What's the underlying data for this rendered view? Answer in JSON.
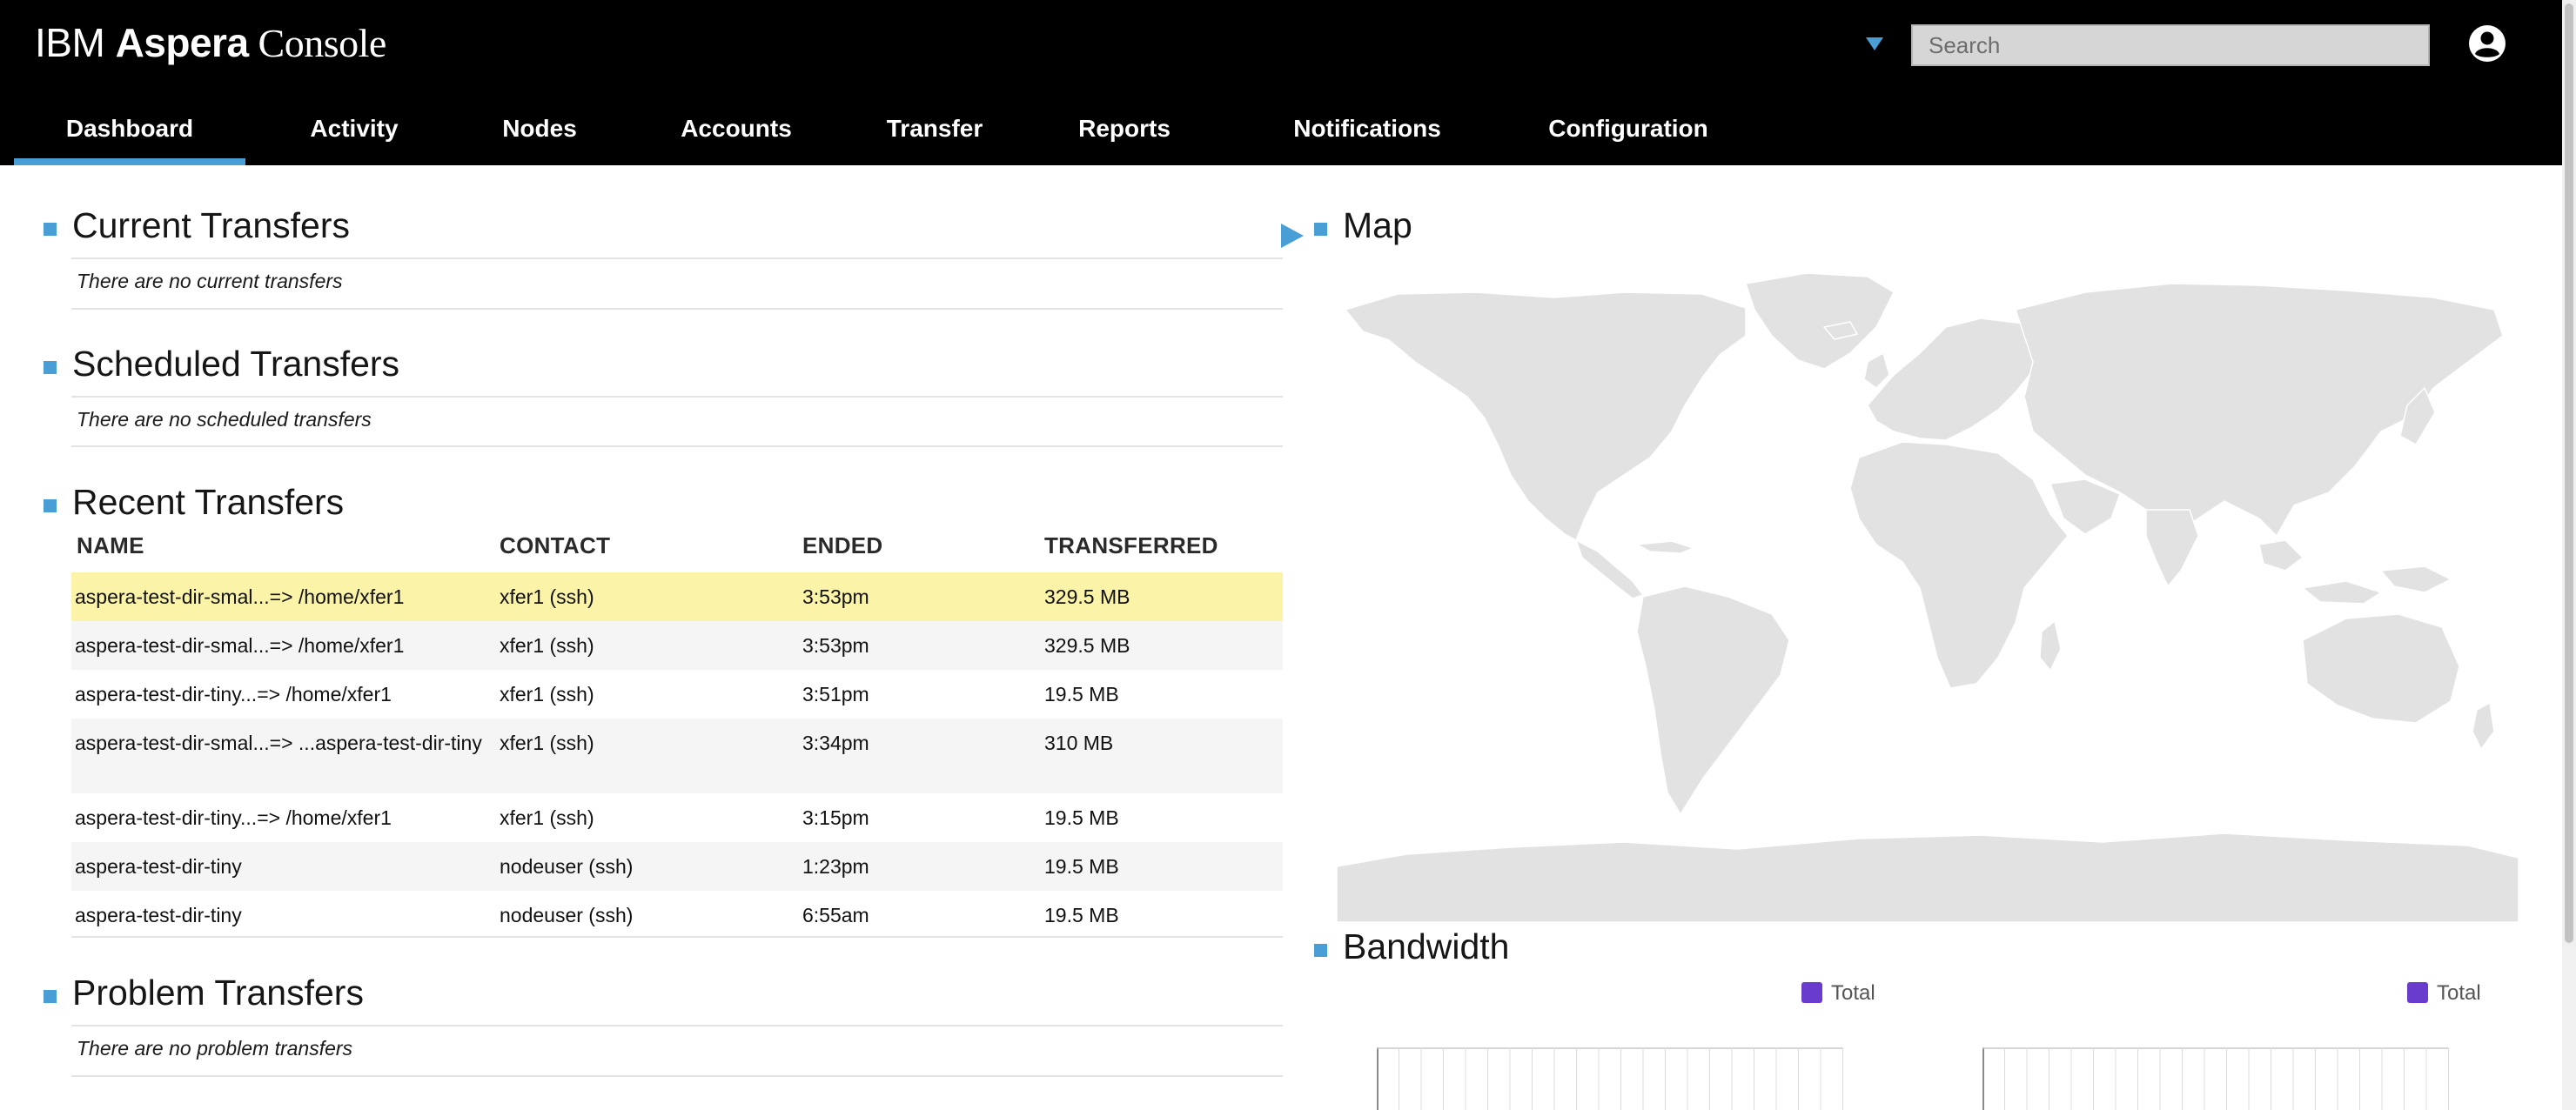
{
  "header": {
    "logo": {
      "part1": "IBM ",
      "part2": "Aspera",
      "part3": " Console"
    },
    "search_placeholder": "Search",
    "tabs": [
      {
        "label": "Dashboard",
        "active": true
      },
      {
        "label": "Activity"
      },
      {
        "label": "Nodes"
      },
      {
        "label": "Accounts"
      },
      {
        "label": "Transfer"
      },
      {
        "label": "Reports"
      },
      {
        "label": "Notifications"
      },
      {
        "label": "Configuration"
      }
    ],
    "icons": {
      "filter": "triangle-down-icon",
      "user": "user-avatar-icon"
    }
  },
  "current_transfers": {
    "title": "Current Transfers",
    "empty": "There are no current transfers"
  },
  "scheduled_transfers": {
    "title": "Scheduled Transfers",
    "empty": "There are no scheduled transfers"
  },
  "recent_transfers": {
    "title": "Recent Transfers",
    "columns": [
      "NAME",
      "CONTACT",
      "ENDED",
      "TRANSFERRED"
    ],
    "rows": [
      {
        "name": "aspera-test-dir-smal...=> /home/xfer1",
        "contact": "xfer1 (ssh)",
        "ended": "3:53pm",
        "transferred": "329.5 MB"
      },
      {
        "name": "aspera-test-dir-smal...=> /home/xfer1",
        "contact": "xfer1 (ssh)",
        "ended": "3:53pm",
        "transferred": "329.5 MB"
      },
      {
        "name": "aspera-test-dir-tiny...=> /home/xfer1",
        "contact": "xfer1 (ssh)",
        "ended": "3:51pm",
        "transferred": "19.5 MB"
      },
      {
        "name": "aspera-test-dir-smal...=> ...aspera-test-dir-tiny",
        "contact": "xfer1 (ssh)",
        "ended": "3:34pm",
        "transferred": "310 MB"
      },
      {
        "name": "aspera-test-dir-tiny...=> /home/xfer1",
        "contact": "xfer1 (ssh)",
        "ended": "3:15pm",
        "transferred": "19.5 MB"
      },
      {
        "name": "aspera-test-dir-tiny",
        "contact": "nodeuser (ssh)",
        "ended": "1:23pm",
        "transferred": "19.5 MB"
      },
      {
        "name": "aspera-test-dir-tiny",
        "contact": "nodeuser (ssh)",
        "ended": "6:55am",
        "transferred": "19.5 MB"
      }
    ]
  },
  "problem_transfers": {
    "title": "Problem Transfers",
    "empty": "There are no problem transfers"
  },
  "map": {
    "title": "Map",
    "land_color": "#e2e2e2"
  },
  "bandwidth": {
    "title": "Bandwidth",
    "legends": [
      {
        "label": "Total",
        "color": "#6a3ccd"
      },
      {
        "label": "Total",
        "color": "#6a3ccd"
      }
    ]
  },
  "colors": {
    "accent": "#4a9ed6",
    "highlight_row": "#faf3a8",
    "header_bg": "#000000"
  }
}
